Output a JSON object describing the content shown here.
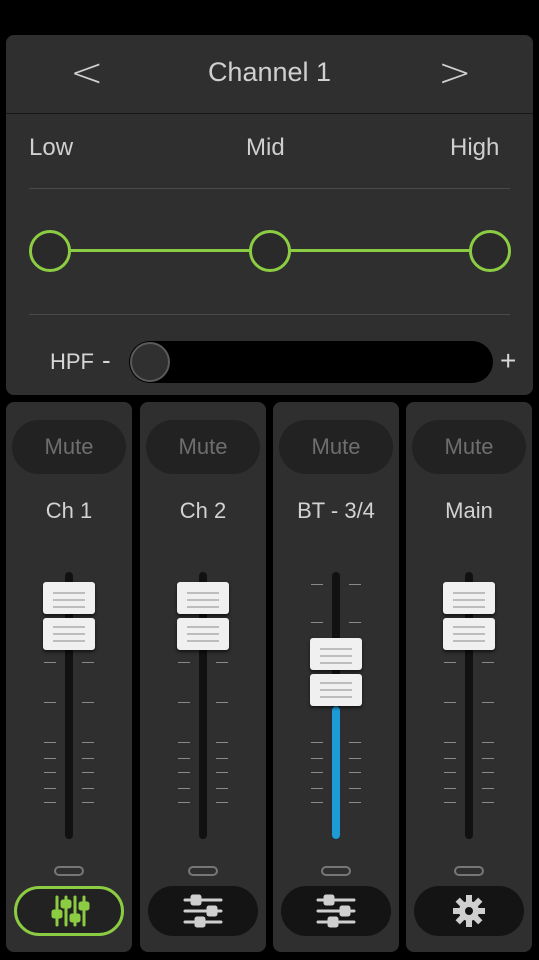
{
  "header": {
    "prev": "<",
    "title": "Channel 1",
    "next": ">"
  },
  "eq": {
    "bands": [
      "Low",
      "Mid",
      "High"
    ],
    "accent_color": "#8ccc43",
    "levels": {
      "low": 0.5,
      "mid": 0.5,
      "high": 0.5
    }
  },
  "hpf": {
    "label": "HPF",
    "minus": "-",
    "plus": "+",
    "value": 0.0
  },
  "strips": [
    {
      "mute": "Mute",
      "name": "Ch 1",
      "fader_level": 0.95,
      "icon": "mixer-sliders-icon",
      "active": true
    },
    {
      "mute": "Mute",
      "name": "Ch 2",
      "fader_level": 0.95,
      "icon": "eq-settings-icon",
      "active": false
    },
    {
      "mute": "Mute",
      "name": "BT - 3/4",
      "fader_level": 0.68,
      "icon": "eq-settings-icon",
      "active": false,
      "fill_color": "#1c9bd6"
    },
    {
      "mute": "Mute",
      "name": "Main",
      "fader_level": 0.95,
      "icon": "gear-icon",
      "active": false
    }
  ]
}
